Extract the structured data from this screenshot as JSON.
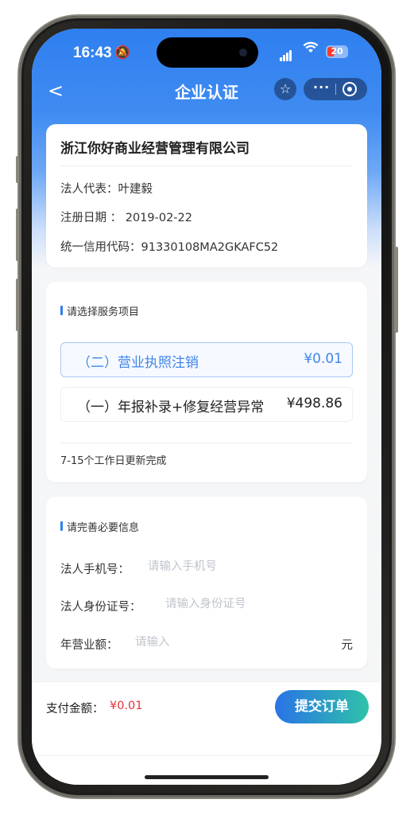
{
  "status_bar": {
    "time": "16:43",
    "battery": "20"
  },
  "nav": {
    "back": "<",
    "title": "企业认证",
    "more": "···"
  },
  "company": {
    "name": "浙江你好商业经营管理有限公司",
    "legal_rep": "法人代表：叶建毅",
    "reg_date": "注册日期 ： 2019-02-22",
    "credit_code": "统一信用代码：91330108MA2GKAFC52"
  },
  "service": {
    "section_title": "请选择服务项目",
    "items": [
      {
        "name": "（二）营业执照注销",
        "price": "¥0.01",
        "selected": true
      },
      {
        "name": "（一）年报补录+修复经营异常",
        "price": "¥498.86",
        "selected": false
      }
    ],
    "note": "7-15个工作日更新完成"
  },
  "form": {
    "section_title": "请完善必要信息",
    "phone_label": "法人手机号：",
    "phone_placeholder": "请输入手机号",
    "id_label": "法人身份证号：",
    "id_placeholder": "请输入身份证号",
    "revenue_label": "年营业额：",
    "revenue_placeholder": "请输入",
    "revenue_unit": "元"
  },
  "footer": {
    "pay_label": "支付金额：",
    "pay_amount": "¥0.01",
    "submit_label": "提交订单"
  },
  "colors": {
    "primary": "#2f7ff0",
    "price_red": "#e8333a",
    "button_gradient_end": "#2ec2a8"
  }
}
